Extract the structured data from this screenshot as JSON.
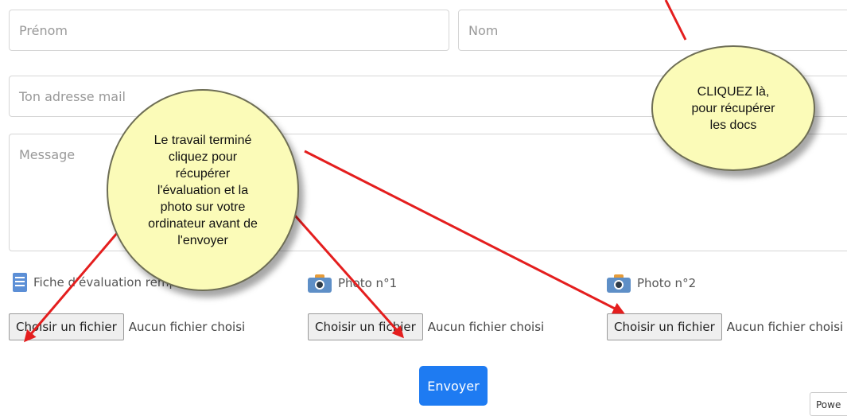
{
  "form": {
    "firstname_placeholder": "Prénom",
    "lastname_placeholder": "Nom",
    "email_placeholder": "Ton adresse mail",
    "message_placeholder": "Message"
  },
  "attachments": [
    {
      "label": "Fiche d'évaluation rempl",
      "icon": "document-icon",
      "button": "Choisir un fichier",
      "status": "Aucun fichier choisi"
    },
    {
      "label": "Photo n°1",
      "icon": "camera-icon",
      "button": "Choisir un fichier",
      "status": "Aucun fichier choisi"
    },
    {
      "label": "Photo n°2",
      "icon": "camera-icon",
      "button": "Choisir un fichier",
      "status": "Aucun fichier choisi"
    }
  ],
  "submit_label": "Envoyer",
  "powered_label": "Powe",
  "callouts": {
    "left": [
      "Le travail terminé",
      "cliquez pour",
      "récupérer",
      "l'évaluation et la",
      "photo sur votre",
      "ordinateur avant de",
      "l'envoyer"
    ],
    "right": [
      "CLIQUEZ là,",
      "pour récupérer",
      "les docs"
    ]
  },
  "colors": {
    "submit": "#1e7bf2",
    "bubble": "#fbfbb8",
    "arrow": "#e41e1e"
  }
}
